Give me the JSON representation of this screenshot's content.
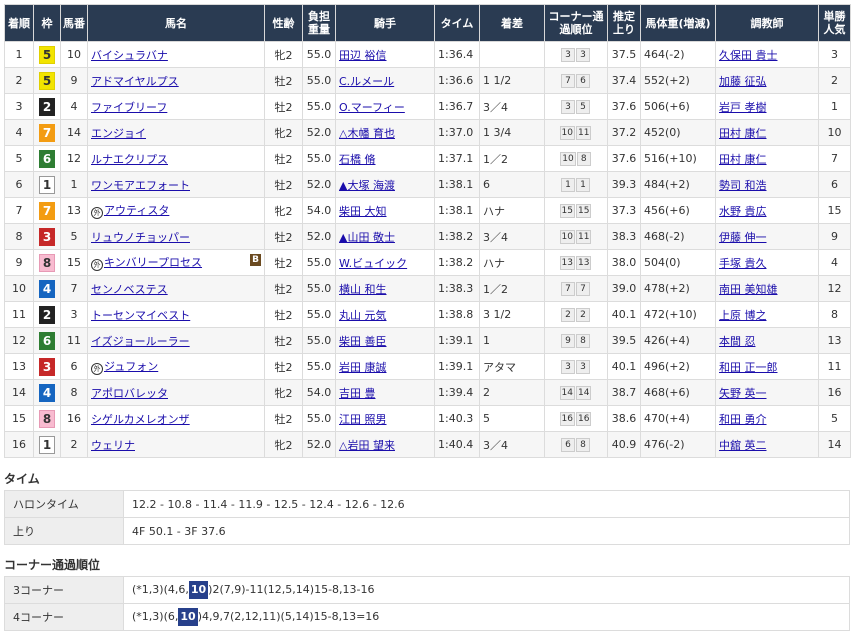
{
  "headers": {
    "rank": "着順",
    "waku": "枠",
    "num": "馬番",
    "name": "馬名",
    "sexage": "性齢",
    "weight": "負担重量",
    "jockey": "騎手",
    "time": "タイム",
    "margin": "着差",
    "corner": "コーナー通過順位",
    "last3f": "推定上り",
    "body": "馬体重(増減)",
    "trainer": "調教師",
    "pop": "単勝人気"
  },
  "rows": [
    {
      "rank": "1",
      "waku": "5",
      "num": "10",
      "mark": "",
      "name": "バイシュラバナ",
      "blinker": "",
      "sexage": "牝2",
      "weight": "55.0",
      "jockey": "田辺 裕信",
      "time": "1:36.4",
      "margin": "",
      "c1": "3",
      "c2": "3",
      "last3f": "37.5",
      "body": "464(-2)",
      "trainer": "久保田 貴士",
      "pop": "3"
    },
    {
      "rank": "2",
      "waku": "5",
      "num": "9",
      "mark": "",
      "name": "アドマイヤルプス",
      "blinker": "",
      "sexage": "牡2",
      "weight": "55.0",
      "jockey": "C.ルメール",
      "time": "1:36.6",
      "margin": "1 1/2",
      "c1": "7",
      "c2": "6",
      "last3f": "37.4",
      "body": "552(+2)",
      "trainer": "加藤 征弘",
      "pop": "2"
    },
    {
      "rank": "3",
      "waku": "2",
      "num": "4",
      "mark": "",
      "name": "ファイブリーフ",
      "blinker": "",
      "sexage": "牡2",
      "weight": "55.0",
      "jockey": "O.マーフィー",
      "time": "1:36.7",
      "margin": "3／4",
      "c1": "3",
      "c2": "5",
      "last3f": "37.6",
      "body": "506(+6)",
      "trainer": "岩戸 孝樹",
      "pop": "1"
    },
    {
      "rank": "4",
      "waku": "7",
      "num": "14",
      "mark": "",
      "name": "エンジョイ",
      "blinker": "",
      "sexage": "牝2",
      "weight": "52.0",
      "jockey": "△木幡 育也",
      "time": "1:37.0",
      "margin": "1 3/4",
      "c1": "10",
      "c2": "11",
      "last3f": "37.2",
      "body": "452(0)",
      "trainer": "田村 康仁",
      "pop": "10"
    },
    {
      "rank": "5",
      "waku": "6",
      "num": "12",
      "mark": "",
      "name": "ルナエクリプス",
      "blinker": "",
      "sexage": "牡2",
      "weight": "55.0",
      "jockey": "石橋 脩",
      "time": "1:37.1",
      "margin": "1／2",
      "c1": "10",
      "c2": "8",
      "last3f": "37.6",
      "body": "516(+10)",
      "trainer": "田村 康仁",
      "pop": "7"
    },
    {
      "rank": "6",
      "waku": "1",
      "num": "1",
      "mark": "",
      "name": "ワンモアエフォート",
      "blinker": "",
      "sexage": "牡2",
      "weight": "52.0",
      "jockey": "▲大塚 海渡",
      "time": "1:38.1",
      "margin": "6",
      "c1": "1",
      "c2": "1",
      "last3f": "39.3",
      "body": "484(+2)",
      "trainer": "勢司 和浩",
      "pop": "6"
    },
    {
      "rank": "7",
      "waku": "7",
      "num": "13",
      "mark": "外",
      "name": "アウティスタ",
      "blinker": "",
      "sexage": "牝2",
      "weight": "54.0",
      "jockey": "柴田 大知",
      "time": "1:38.1",
      "margin": "ハナ",
      "c1": "15",
      "c2": "15",
      "last3f": "37.3",
      "body": "456(+6)",
      "trainer": "水野 貴広",
      "pop": "15"
    },
    {
      "rank": "8",
      "waku": "3",
      "num": "5",
      "mark": "",
      "name": "リュウノチョッパー",
      "blinker": "",
      "sexage": "牡2",
      "weight": "52.0",
      "jockey": "▲山田 敬士",
      "time": "1:38.2",
      "margin": "3／4",
      "c1": "10",
      "c2": "11",
      "last3f": "38.3",
      "body": "468(-2)",
      "trainer": "伊藤 伸一",
      "pop": "9"
    },
    {
      "rank": "9",
      "waku": "8",
      "num": "15",
      "mark": "外",
      "name": "キンバリープロセス",
      "blinker": "B",
      "sexage": "牡2",
      "weight": "55.0",
      "jockey": "W.ビュイック",
      "time": "1:38.2",
      "margin": "ハナ",
      "c1": "13",
      "c2": "13",
      "last3f": "38.0",
      "body": "504(0)",
      "trainer": "手塚 貴久",
      "pop": "4"
    },
    {
      "rank": "10",
      "waku": "4",
      "num": "7",
      "mark": "",
      "name": "センノベステス",
      "blinker": "",
      "sexage": "牡2",
      "weight": "55.0",
      "jockey": "横山 和生",
      "time": "1:38.3",
      "margin": "1／2",
      "c1": "7",
      "c2": "7",
      "last3f": "39.0",
      "body": "478(+2)",
      "trainer": "南田 美知雄",
      "pop": "12"
    },
    {
      "rank": "11",
      "waku": "2",
      "num": "3",
      "mark": "",
      "name": "トーセンマイベスト",
      "blinker": "",
      "sexage": "牡2",
      "weight": "55.0",
      "jockey": "丸山 元気",
      "time": "1:38.8",
      "margin": "3 1/2",
      "c1": "2",
      "c2": "2",
      "last3f": "40.1",
      "body": "472(+10)",
      "trainer": "上原 博之",
      "pop": "8"
    },
    {
      "rank": "12",
      "waku": "6",
      "num": "11",
      "mark": "",
      "name": "イズジョールーラー",
      "blinker": "",
      "sexage": "牡2",
      "weight": "55.0",
      "jockey": "柴田 善臣",
      "time": "1:39.1",
      "margin": "1",
      "c1": "9",
      "c2": "8",
      "last3f": "39.5",
      "body": "426(+4)",
      "trainer": "本間 忍",
      "pop": "13"
    },
    {
      "rank": "13",
      "waku": "3",
      "num": "6",
      "mark": "外",
      "name": "ジュフォン",
      "blinker": "",
      "sexage": "牡2",
      "weight": "55.0",
      "jockey": "岩田 康誠",
      "time": "1:39.1",
      "margin": "アタマ",
      "c1": "3",
      "c2": "3",
      "last3f": "40.1",
      "body": "496(+2)",
      "trainer": "和田 正一郎",
      "pop": "11"
    },
    {
      "rank": "14",
      "waku": "4",
      "num": "8",
      "mark": "",
      "name": "アポロバレッタ",
      "blinker": "",
      "sexage": "牝2",
      "weight": "54.0",
      "jockey": "吉田 豊",
      "time": "1:39.4",
      "margin": "2",
      "c1": "14",
      "c2": "14",
      "last3f": "38.7",
      "body": "468(+6)",
      "trainer": "矢野 英一",
      "pop": "16"
    },
    {
      "rank": "15",
      "waku": "8",
      "num": "16",
      "mark": "",
      "name": "シゲルカメレオンザ",
      "blinker": "",
      "sexage": "牡2",
      "weight": "55.0",
      "jockey": "江田 照男",
      "time": "1:40.3",
      "margin": "5",
      "c1": "16",
      "c2": "16",
      "last3f": "38.6",
      "body": "470(+4)",
      "trainer": "和田 勇介",
      "pop": "5"
    },
    {
      "rank": "16",
      "waku": "1",
      "num": "2",
      "mark": "",
      "name": "ウェリナ",
      "blinker": "",
      "sexage": "牝2",
      "weight": "52.0",
      "jockey": "△岩田 望来",
      "time": "1:40.4",
      "margin": "3／4",
      "c1": "6",
      "c2": "8",
      "last3f": "40.9",
      "body": "476(-2)",
      "trainer": "中舘 英二",
      "pop": "14"
    }
  ],
  "time_section": {
    "title": "タイム",
    "halon_label": "ハロンタイム",
    "halon_value": "12.2 - 10.8 - 11.4 - 11.9 - 12.5 - 12.4 - 12.6 - 12.6",
    "agari_label": "上り",
    "agari_value": "4F 50.1 - 3F 37.6"
  },
  "corner_section": {
    "title": "コーナー通過順位",
    "c3_label": "3コーナー",
    "c3_pre": "(*1,3)(4,6,",
    "c3_hl": "10",
    "c3_post": ")2(7,9)-11(12,5,14)15-8,13-16",
    "c4_label": "4コーナー",
    "c4_pre": "(*1,3)(6,",
    "c4_hl": "10",
    "c4_post": ")4,9,7(2,12,11)(5,14)15-8,13=16"
  },
  "colors": {
    "header_bg": "#2a3b52",
    "link": "#1a0dab",
    "highlight": "#27408b"
  }
}
